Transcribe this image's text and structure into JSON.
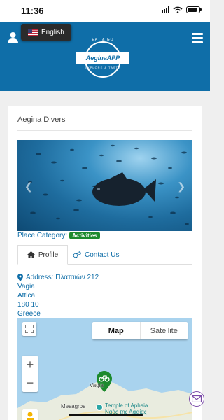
{
  "status_bar": {
    "time": "11:36"
  },
  "header": {
    "language": "English",
    "logo": {
      "top_text": "EAT & GO",
      "brand": "AeginaAPP",
      "bottom_text": "EXPLORE & TASTE"
    },
    "color": "#0f6ea8"
  },
  "place": {
    "title": "Aegina Divers",
    "category_label": "Place Category:",
    "category": "Activities",
    "category_color": "#1d8a2e"
  },
  "tabs": [
    {
      "label": "Profile",
      "icon": "home-icon",
      "active": true
    },
    {
      "label": "Contact Us",
      "icon": "cogs-icon",
      "active": false
    }
  ],
  "address": {
    "line1": "Address: Πλαταιών 212",
    "city": "Vagia",
    "region": "Attica",
    "postcode": "180 10",
    "country": "Greece"
  },
  "map": {
    "types": [
      "Map",
      "Satellite"
    ],
    "selected_type": "Map",
    "zoom_in": "+",
    "zoom_out": "−",
    "labels": {
      "marker_town": "Vagia",
      "mesagros": "Mesagros",
      "temple": "Temple of Aphaia",
      "temple_greek": "Ναός της Αφαίας"
    }
  }
}
